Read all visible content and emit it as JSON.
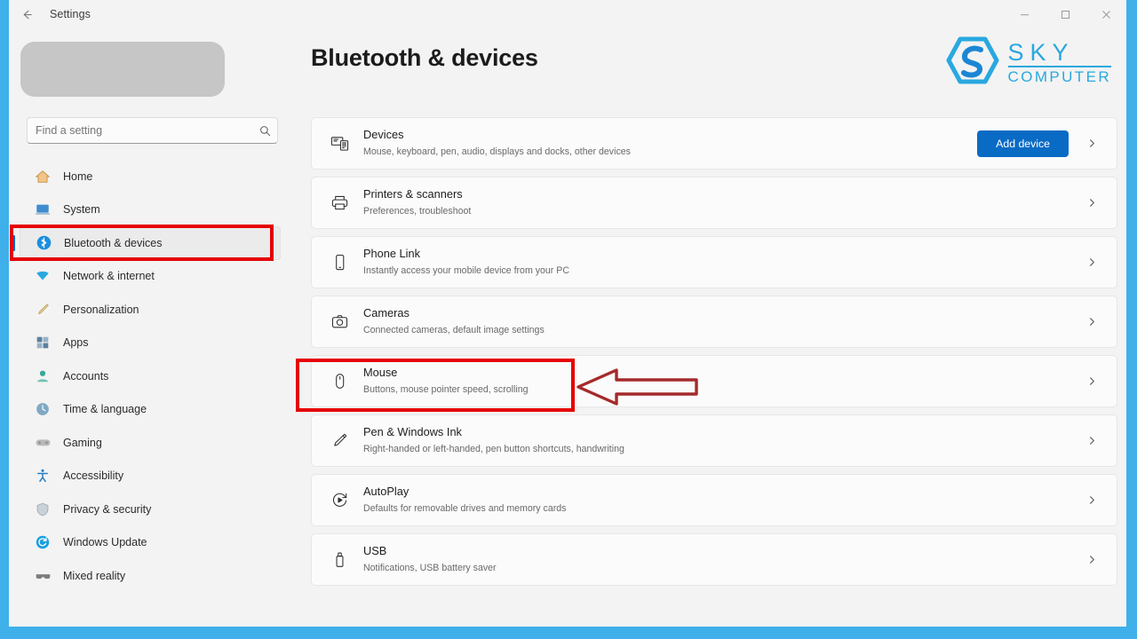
{
  "window": {
    "app_title": "Settings",
    "back_icon": "back-arrow-icon",
    "minimize_label": "─",
    "maximize_label": "☐",
    "close_label": "✕"
  },
  "sidebar": {
    "search": {
      "placeholder": "Find a setting",
      "value": "",
      "icon": "search-icon"
    },
    "items": [
      {
        "label": "Home",
        "icon": "home-icon",
        "selected": false
      },
      {
        "label": "System",
        "icon": "system-icon",
        "selected": false
      },
      {
        "label": "Bluetooth & devices",
        "icon": "bluetooth-icon",
        "selected": true
      },
      {
        "label": "Network & internet",
        "icon": "network-icon",
        "selected": false
      },
      {
        "label": "Personalization",
        "icon": "personalization-icon",
        "selected": false
      },
      {
        "label": "Apps",
        "icon": "apps-icon",
        "selected": false
      },
      {
        "label": "Accounts",
        "icon": "accounts-icon",
        "selected": false
      },
      {
        "label": "Time & language",
        "icon": "time-language-icon",
        "selected": false
      },
      {
        "label": "Gaming",
        "icon": "gaming-icon",
        "selected": false
      },
      {
        "label": "Accessibility",
        "icon": "accessibility-icon",
        "selected": false
      },
      {
        "label": "Privacy & security",
        "icon": "privacy-icon",
        "selected": false
      },
      {
        "label": "Windows Update",
        "icon": "windows-update-icon",
        "selected": false
      },
      {
        "label": "Mixed reality",
        "icon": "mixed-reality-icon",
        "selected": false
      }
    ]
  },
  "main": {
    "page_title": "Bluetooth & devices",
    "logo": {
      "line1": "SKY",
      "line2": "COMPUTER",
      "color": "#29a8e0"
    },
    "cards": [
      {
        "title": "Devices",
        "subtitle": "Mouse, keyboard, pen, audio, displays and docks, other devices",
        "icon": "devices-icon",
        "button": "Add device",
        "chevron": "chevron-right-icon"
      },
      {
        "title": "Printers & scanners",
        "subtitle": "Preferences, troubleshoot",
        "icon": "printer-icon",
        "chevron": "chevron-right-icon"
      },
      {
        "title": "Phone Link",
        "subtitle": "Instantly access your mobile device from your PC",
        "icon": "phone-icon",
        "chevron": "chevron-right-icon"
      },
      {
        "title": "Cameras",
        "subtitle": "Connected cameras, default image settings",
        "icon": "camera-icon",
        "chevron": "chevron-right-icon"
      },
      {
        "title": "Mouse",
        "subtitle": "Buttons, mouse pointer speed, scrolling",
        "icon": "mouse-icon",
        "chevron": "chevron-right-icon"
      },
      {
        "title": "Pen & Windows Ink",
        "subtitle": "Right-handed or left-handed, pen button shortcuts, handwriting",
        "icon": "pen-icon",
        "chevron": "chevron-right-icon"
      },
      {
        "title": "AutoPlay",
        "subtitle": "Defaults for removable drives and memory cards",
        "icon": "autoplay-icon",
        "chevron": "chevron-right-icon"
      },
      {
        "title": "USB",
        "subtitle": "Notifications, USB battery saver",
        "icon": "usb-icon",
        "chevron": "chevron-right-icon"
      }
    ]
  },
  "annotations": {
    "highlight_color": "#e60000",
    "arrow_color": "#a52a2a",
    "boxes": [
      "sidebar-bluetooth-devices",
      "card-mouse"
    ],
    "arrow": "left-pointing-arrow"
  },
  "theme": {
    "frame_color": "#3fb0ea",
    "accent": "#0a6bc4",
    "window_bg": "#f3f3f3",
    "card_bg": "#fbfbfb"
  }
}
